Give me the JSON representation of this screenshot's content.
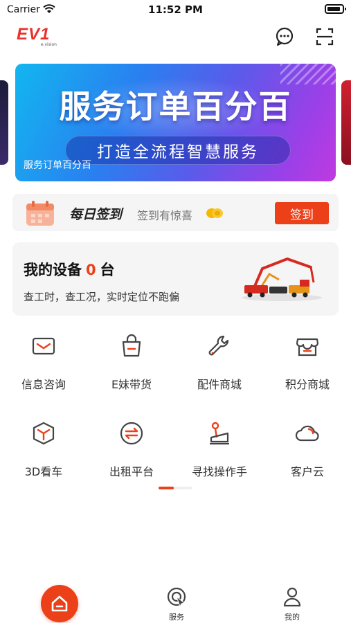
{
  "status_bar": {
    "carrier": "Carrier",
    "time": "11:52 PM"
  },
  "header": {
    "logo_text": "EV1",
    "logo_sub": "e.vision",
    "message_icon": "chat-bubble-icon",
    "scan_icon": "scan-icon"
  },
  "banner": {
    "headline": "服务订单百分百",
    "subline": "打造全流程智慧服务",
    "caption": "服务订单百分百"
  },
  "checkin": {
    "brand": "每日签到",
    "hint": "签到有惊喜",
    "button_label": "签到"
  },
  "device_card": {
    "title_prefix": "我的设备",
    "count": "0",
    "title_suffix": "台",
    "description": "查工时，查工况，实时定位不跑偏"
  },
  "grid": {
    "items": [
      {
        "label": "信息咨询",
        "icon": "mail-icon"
      },
      {
        "label": "E妹带货",
        "icon": "shopping-bag-icon"
      },
      {
        "label": "配件商城",
        "icon": "wrench-icon"
      },
      {
        "label": "积分商城",
        "icon": "store-icon"
      },
      {
        "label": "3D看车",
        "icon": "cube-icon"
      },
      {
        "label": "出租平台",
        "icon": "exchange-icon"
      },
      {
        "label": "寻找操作手",
        "icon": "joystick-icon"
      },
      {
        "label": "客户云",
        "icon": "cloud-icon"
      }
    ]
  },
  "pager": {
    "pages": 2,
    "current": 1
  },
  "tabbar": {
    "items": [
      {
        "label": "",
        "icon": "home-icon",
        "active": true
      },
      {
        "label": "服务",
        "icon": "service-icon",
        "active": false
      },
      {
        "label": "我的",
        "icon": "person-icon",
        "active": false
      }
    ]
  },
  "colors": {
    "accent": "#ec4019",
    "card_bg": "#f5f5f5"
  }
}
